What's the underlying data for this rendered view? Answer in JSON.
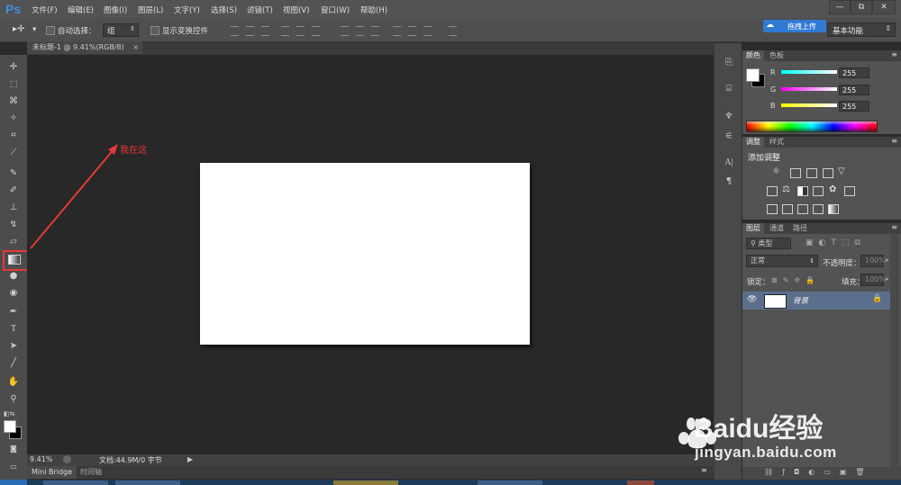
{
  "app": {
    "logo": "Ps",
    "menu": [
      "文件(F)",
      "编辑(E)",
      "图像(I)",
      "图层(L)",
      "文字(Y)",
      "选择(S)",
      "滤镜(T)",
      "视图(V)",
      "窗口(W)",
      "帮助(H)"
    ],
    "upload_button": "拖拽上传",
    "workspace": "基本功能",
    "window_controls": [
      "—",
      "⧉",
      "✕"
    ]
  },
  "options": {
    "auto_select_label": "自动选择：",
    "auto_select_value": "组",
    "show_transform_label": "显示变换控件"
  },
  "document": {
    "tab_title": "未标题-1 @ 9.41%(RGB/8)",
    "tab_close": "×",
    "zoom": "9.41%",
    "doc_info": "文档:44.9M/0 字节"
  },
  "bottom_tabs": [
    "Mini Bridge",
    "时间轴"
  ],
  "annotation": {
    "text": "我在这",
    "color": "#e53935"
  },
  "color_panel": {
    "tabs": [
      "颜色",
      "色板"
    ],
    "channels": [
      {
        "label": "R",
        "value": "255",
        "color": "#ff4444"
      },
      {
        "label": "G",
        "value": "255",
        "color": "#e040e0"
      },
      {
        "label": "B",
        "value": "255",
        "color": "#f0f040"
      }
    ]
  },
  "adjust_panel": {
    "tabs": [
      "调整",
      "样式"
    ],
    "heading": "添加调整"
  },
  "layers_panel": {
    "tabs": [
      "图层",
      "通道",
      "路径"
    ],
    "filter": "类型",
    "blend_mode": "正常",
    "opacity_label": "不透明度：",
    "opacity_value": "100%",
    "lock_label": "锁定：",
    "fill_label": "填充：",
    "fill_value": "100%",
    "layer_name": "背景"
  },
  "watermark": {
    "brand": "Baidu经验",
    "url": "jingyan.baidu.com"
  }
}
